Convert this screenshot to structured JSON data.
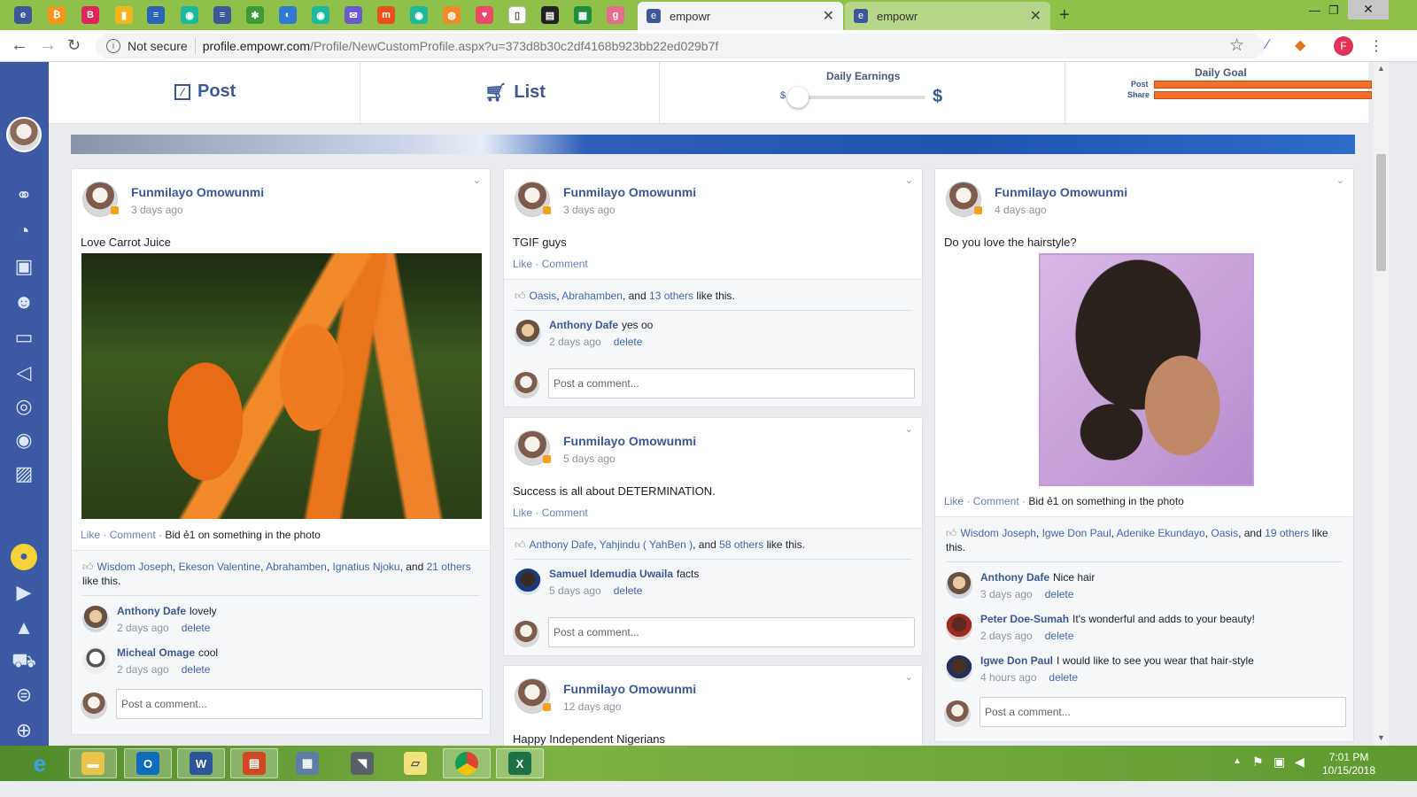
{
  "browser": {
    "tabs": [
      {
        "title": "empowr",
        "active": true
      },
      {
        "title": "empowr",
        "active": false
      }
    ],
    "security_label": "Not secure",
    "url_host": "profile.empowr.com",
    "url_path": "/Profile/NewCustomProfile.aspx?u=373d8b30c2df4168b923bb22ed029b7f",
    "profile_initial": "F"
  },
  "topbar": {
    "post_label": "Post",
    "list_label": "List",
    "earnings_label": "Daily Earnings",
    "earnings_left": "$",
    "earnings_right": "$",
    "goal_label": "Daily Goal",
    "goal_post_label": "Post",
    "goal_share_label": "Share"
  },
  "posts": [
    {
      "author": "Funmilayo Omowunmi",
      "time": "3 days ago",
      "text": "Love Carrot Juice",
      "like": "Like",
      "comment": "Comment",
      "bid": "Bid ẻ1 on something in the photo",
      "likers": [
        "Wisdom Joseph",
        "Ekeson Valentine",
        "Abrahamben",
        "Ignatius Njoku"
      ],
      "and_word": ", and",
      "others": "21 others",
      "like_suffix": "like this.",
      "comments": [
        {
          "name": "Anthony Dafe",
          "text": "lovely",
          "time": "2 days ago",
          "delete": "delete"
        },
        {
          "name": "Micheal Omage",
          "text": "cool",
          "time": "2 days ago",
          "delete": "delete"
        }
      ],
      "placeholder": "Post a comment..."
    },
    {
      "author": "Funmilayo Omowunmi",
      "time": "3 days ago",
      "text": "TGIF guys",
      "like": "Like",
      "comment": "Comment",
      "likers": [
        "Oasis",
        "Abrahamben"
      ],
      "and_word": ", and",
      "others": "13 others",
      "like_suffix": "like this.",
      "comments": [
        {
          "name": "Anthony Dafe",
          "text": "yes oo",
          "time": "2 days ago",
          "delete": "delete"
        }
      ],
      "placeholder": "Post a comment..."
    },
    {
      "author": "Funmilayo Omowunmi",
      "time": "5 days ago",
      "text": "Success is all about DETERMINATION.",
      "like": "Like",
      "comment": "Comment",
      "likers": [
        "Anthony Dafe",
        "Yahjindu ( YahBen )"
      ],
      "and_word": ", and",
      "others": "58 others",
      "like_suffix": "like this.",
      "comments": [
        {
          "name": "Samuel Idemudia Uwaila",
          "text": "facts",
          "time": "5 days ago",
          "delete": "delete"
        }
      ],
      "placeholder": "Post a comment..."
    },
    {
      "author": "Funmilayo Omowunmi",
      "time": "12 days ago",
      "text": "Happy Independent Nigerians"
    },
    {
      "author": "Funmilayo Omowunmi",
      "time": "4 days ago",
      "text": "Do you love the hairstyle?",
      "like": "Like",
      "comment": "Comment",
      "bid": "Bid ẻ1 on something in the photo",
      "likers": [
        "Wisdom Joseph",
        "Igwe Don Paul",
        "Adenike Ekundayo",
        "Oasis"
      ],
      "and_word": ", and",
      "others": "19 others",
      "like_suffix": "like this.",
      "comments": [
        {
          "name": "Anthony Dafe",
          "text": "Nice hair",
          "time": "3 days ago",
          "delete": "delete"
        },
        {
          "name": "Peter Doe-Sumah",
          "text": "It's wonderful and adds to your beauty!",
          "time": "2 days ago",
          "delete": "delete"
        },
        {
          "name": "Igwe Don Paul",
          "text": "I would like to see you wear that hair-style",
          "time": "4 hours ago",
          "delete": "delete"
        }
      ],
      "placeholder": "Post a comment..."
    }
  ],
  "taskbar": {
    "time": "7:01 PM",
    "date": "10/15/2018"
  },
  "colors": {
    "brand_blue": "#3b5998",
    "sidebar": "#3b5aa3",
    "tab_strip": "#8fc14a",
    "goal_bar": "#f36f2a"
  }
}
